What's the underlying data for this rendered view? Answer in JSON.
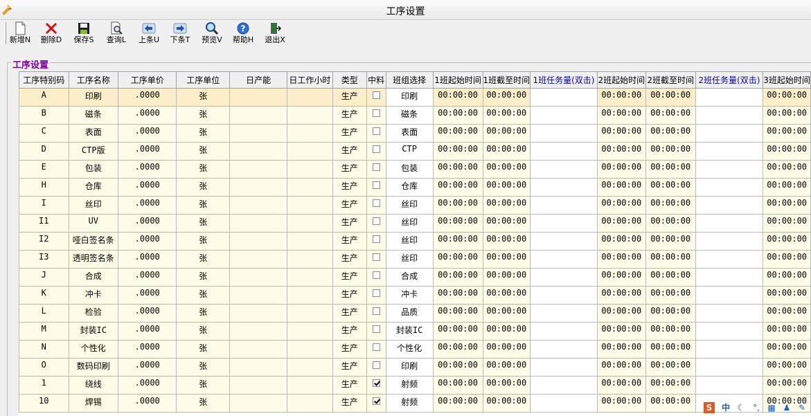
{
  "window": {
    "title": "工序设置"
  },
  "toolbar": {
    "buttons": [
      {
        "label": "新增N",
        "icon": "new-doc-icon"
      },
      {
        "label": "删除D",
        "icon": "delete-x-icon"
      },
      {
        "label": "保存S",
        "icon": "save-disk-icon"
      },
      {
        "label": "查询L",
        "icon": "search-doc-icon"
      },
      {
        "label": "上条U",
        "icon": "arrow-left-icon"
      },
      {
        "label": "下条T",
        "icon": "arrow-right-icon"
      },
      {
        "label": "预览V",
        "icon": "magnifier-icon"
      },
      {
        "label": "帮助H",
        "icon": "help-icon"
      },
      {
        "label": "退出X",
        "icon": "exit-door-icon"
      }
    ]
  },
  "group": {
    "label": "工序设置"
  },
  "grid": {
    "headers": [
      "工序特别码",
      "工序名称",
      "工序单价",
      "工序单位",
      "日产能",
      "日工作小时",
      "类型",
      "中料",
      "班组选择",
      "1班起始时间",
      "1班截至时间",
      "1班任务量(双击)",
      "2班起始时间",
      "2班截至时间",
      "2班任务量(双击)",
      "3班起始时间"
    ],
    "rows": [
      {
        "code": "A",
        "name": "印刷",
        "price": ".0000",
        "unit": "张",
        "type": "生产",
        "checked": false,
        "team": "印刷"
      },
      {
        "code": "B",
        "name": "磁条",
        "price": ".0000",
        "unit": "张",
        "type": "生产",
        "checked": false,
        "team": "磁条"
      },
      {
        "code": "C",
        "name": "表面",
        "price": ".0000",
        "unit": "张",
        "type": "生产",
        "checked": false,
        "team": "表面"
      },
      {
        "code": "D",
        "name": "CTP版",
        "price": ".0000",
        "unit": "张",
        "type": "生产",
        "checked": false,
        "team": "CTP"
      },
      {
        "code": "E",
        "name": "包装",
        "price": ".0000",
        "unit": "张",
        "type": "生产",
        "checked": false,
        "team": "包装"
      },
      {
        "code": "H",
        "name": "仓库",
        "price": ".0000",
        "unit": "张",
        "type": "生产",
        "checked": false,
        "team": "仓库"
      },
      {
        "code": "I",
        "name": "丝印",
        "price": ".0000",
        "unit": "张",
        "type": "生产",
        "checked": false,
        "team": "丝印"
      },
      {
        "code": "I1",
        "name": "UV",
        "price": ".0000",
        "unit": "张",
        "type": "生产",
        "checked": false,
        "team": "丝印"
      },
      {
        "code": "I2",
        "name": "哑白签名条",
        "price": ".0000",
        "unit": "张",
        "type": "生产",
        "checked": false,
        "team": "丝印"
      },
      {
        "code": "I3",
        "name": "透明签名条",
        "price": ".0000",
        "unit": "张",
        "type": "生产",
        "checked": false,
        "team": "丝印"
      },
      {
        "code": "J",
        "name": "合成",
        "price": ".0000",
        "unit": "张",
        "type": "生产",
        "checked": false,
        "team": "合成"
      },
      {
        "code": "K",
        "name": "冲卡",
        "price": ".0000",
        "unit": "张",
        "type": "生产",
        "checked": false,
        "team": "冲卡"
      },
      {
        "code": "L",
        "name": "检验",
        "price": ".0000",
        "unit": "张",
        "type": "生产",
        "checked": false,
        "team": "品质"
      },
      {
        "code": "M",
        "name": "封装IC",
        "price": ".0000",
        "unit": "张",
        "type": "生产",
        "checked": false,
        "team": "封装IC"
      },
      {
        "code": "N",
        "name": "个性化",
        "price": ".0000",
        "unit": "张",
        "type": "生产",
        "checked": false,
        "team": "个性化"
      },
      {
        "code": "O",
        "name": "数码印刷",
        "price": ".0000",
        "unit": "张",
        "type": "生产",
        "checked": false,
        "team": "印刷"
      },
      {
        "code": "1",
        "name": "绕线",
        "price": ".0000",
        "unit": "张",
        "type": "生产",
        "checked": true,
        "team": "射频"
      },
      {
        "code": "10",
        "name": "焊锡",
        "price": ".0000",
        "unit": "张",
        "type": "生产",
        "checked": true,
        "team": "射频"
      }
    ],
    "time_value": "00:00:00",
    "selected_row": 0
  },
  "tray": {
    "ime_label": "中"
  }
}
